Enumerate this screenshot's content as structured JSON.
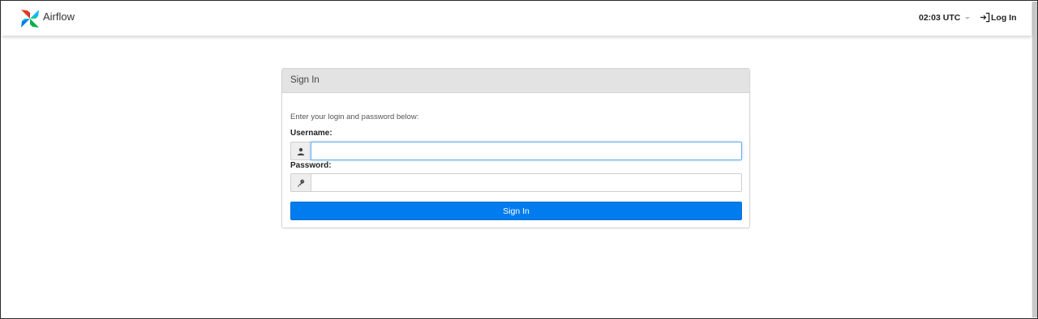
{
  "header": {
    "app_name": "Airflow",
    "clock": "02:03 UTC",
    "login_label": "Log In"
  },
  "login_panel": {
    "title": "Sign In",
    "hint": "Enter your login and password below:",
    "username_label": "Username:",
    "username_value": "",
    "password_label": "Password:",
    "password_value": "",
    "submit_label": "Sign In"
  },
  "icons": {
    "logo": "airflow-pinwheel-icon",
    "login": "sign-in-icon",
    "username": "user-icon",
    "password": "key-icon"
  },
  "colors": {
    "primary": "#017cee",
    "panel_heading": "#e3e3e3",
    "focus_border": "#66afe9"
  }
}
